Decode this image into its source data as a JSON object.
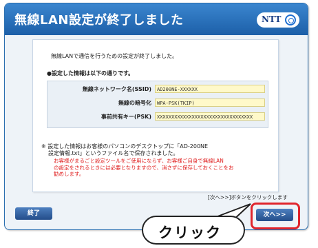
{
  "window": {
    "title": "無線LAN設定が終了しました",
    "brand": "NTT"
  },
  "content": {
    "intro": "無線LANで通信を行うための設定が終了しました。",
    "settings_heading": "●設定した情報は以下の通りです。",
    "fields": [
      {
        "label": "無線ネットワーク名(SSID)",
        "value": "AD200NE-XXXXXX"
      },
      {
        "label": "無線の暗号化",
        "value": "WPA-PSK(TKIP)"
      },
      {
        "label": "事前共有キー(PSK)",
        "value": "XXXXXXXXXXXXXXXXXXXXXXXXXXXXXXXXX"
      }
    ],
    "note_line1": "※ 設定した情報はお客様のパソコンのデスクトップに「AD-200NE",
    "note_line2": "設定情報.txt」というファイル名で保存されました。",
    "warning_line1": "お客様がまるごと設定ツールをご使用にならず、お客様ご自身で無線LAN",
    "warning_line2": "の設定をされるときには必要となりますので、消さずに保存しておくことをお",
    "warning_line3": "勧めします。"
  },
  "footer": {
    "hint": "[次へ>>]ボタンをクリックします",
    "exit_label": "終了",
    "next_label": "次へ>>"
  },
  "callout": {
    "text": "クリック"
  },
  "colors": {
    "title_bar": "#2a72bd",
    "button": "#2f5c9a",
    "warning_text": "#e02020",
    "field_bg": "#fff9c9",
    "highlight": "#e0242c"
  }
}
